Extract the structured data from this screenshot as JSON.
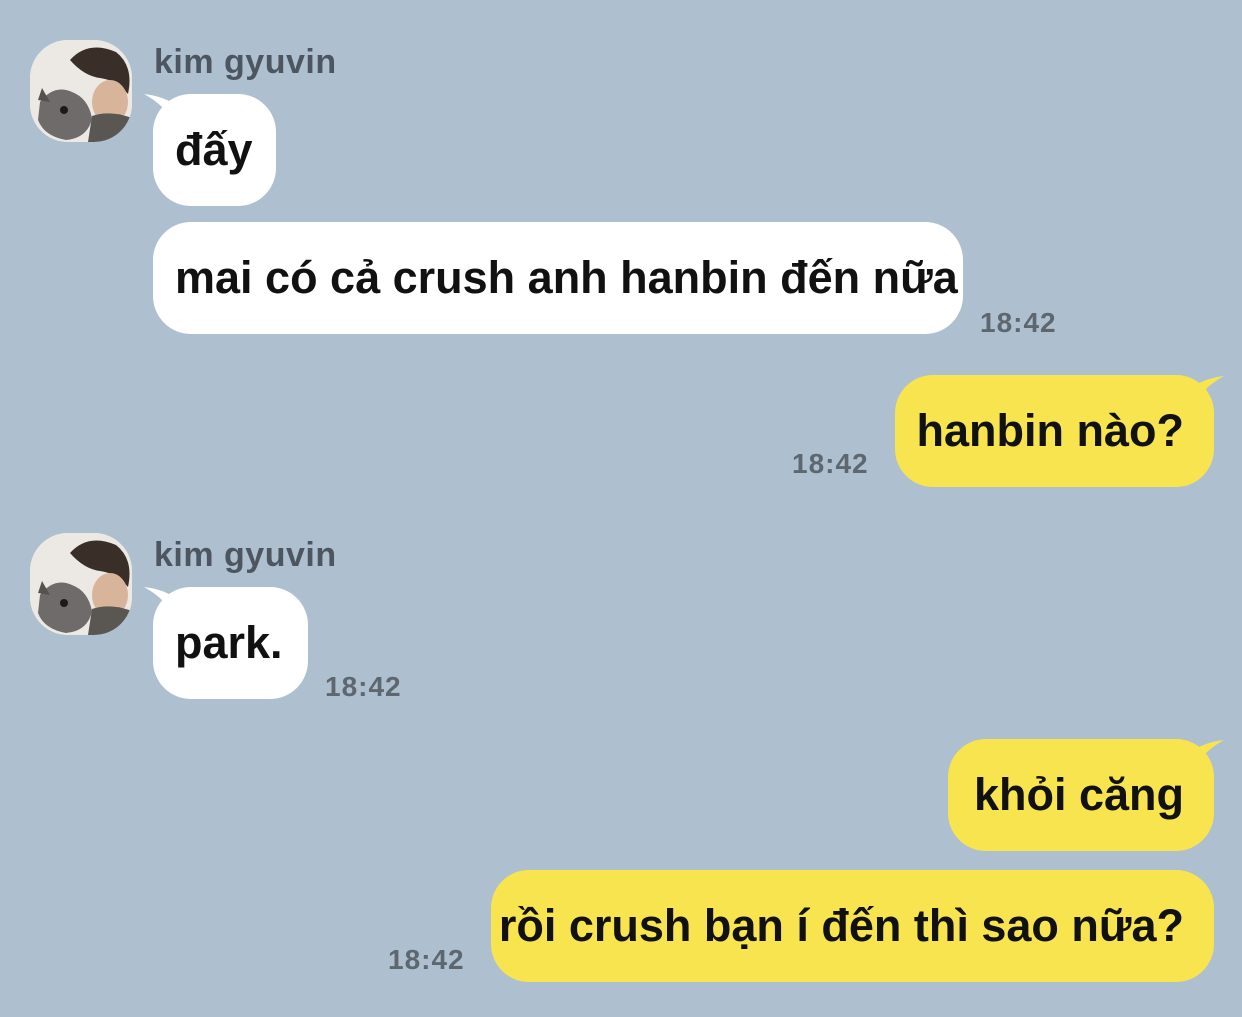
{
  "chat": {
    "messages": [
      {
        "sender": "kim gyuvin",
        "text": "đấy"
      },
      {
        "sender": "kim gyuvin",
        "text": "mai có cả crush anh hanbin đến nữa",
        "time": "18:42"
      },
      {
        "sender": "me",
        "text": "hanbin nào?",
        "time": "18:42"
      },
      {
        "sender": "kim gyuvin",
        "text": "park.",
        "time": "18:42"
      },
      {
        "sender": "me",
        "text": "khỏi căng"
      },
      {
        "sender": "me",
        "text": "rồi crush bạn í đến thì sao nữa?",
        "time": "18:42"
      }
    ]
  },
  "colors": {
    "background": "#aec0cf",
    "incoming_bubble": "#ffffff",
    "outgoing_bubble": "#f8e44f"
  },
  "icons": {
    "avatar": "profile-photo"
  }
}
